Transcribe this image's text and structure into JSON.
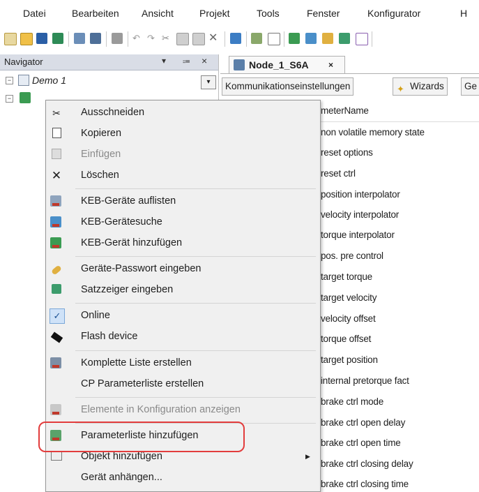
{
  "menubar": {
    "items": [
      "Datei",
      "Bearbeiten",
      "Ansicht",
      "Projekt",
      "Tools",
      "Fenster",
      "Konfigurator",
      "H"
    ]
  },
  "navigator": {
    "title": "Navigator",
    "pin": "▾",
    "dock": "⩴",
    "close": "×",
    "tree_root": "Demo 1"
  },
  "document": {
    "tab_label": "Node_1_S6A",
    "tab_close": "×",
    "subtabs": [
      "Kommunikationseinstellungen",
      "Wizards",
      "Ge"
    ],
    "column_header": "meterName",
    "rows": [
      "non volatile memory state",
      "reset options",
      "reset ctrl",
      "position interpolator",
      "velocity interpolator",
      "torque interpolator",
      "pos. pre control",
      "target torque",
      "target velocity",
      "velocity offset",
      "torque offset",
      "target position",
      "internal pretorque fact",
      "brake ctrl mode",
      "brake ctrl open delay",
      "brake ctrl open time",
      "brake ctrl closing delay",
      "brake ctrl closing time"
    ]
  },
  "context_menu": {
    "items": [
      {
        "label": "Ausschneiden",
        "icon": "scissors-icon",
        "enabled": true
      },
      {
        "label": "Kopieren",
        "icon": "copy-icon",
        "enabled": true
      },
      {
        "label": "Einfügen",
        "icon": "paste-icon",
        "enabled": false
      },
      {
        "label": "Löschen",
        "icon": "delete-icon",
        "enabled": true
      },
      {
        "label": "KEB-Geräte auflisten",
        "icon": "keb-list-icon",
        "enabled": true
      },
      {
        "label": "KEB-Gerätesuche",
        "icon": "keb-search-icon",
        "enabled": true
      },
      {
        "label": "KEB-Gerät hinzufügen",
        "icon": "keb-add-icon",
        "enabled": true
      },
      {
        "label": "Geräte-Passwort eingeben",
        "icon": "key-icon",
        "enabled": true
      },
      {
        "label": "Satzzeiger eingeben",
        "icon": "record-pointer-icon",
        "enabled": true
      },
      {
        "label": "Online",
        "icon": "check-icon",
        "enabled": true,
        "checked": true
      },
      {
        "label": "Flash device",
        "icon": "chip-icon",
        "enabled": true
      },
      {
        "label": "Komplette Liste erstellen",
        "icon": "keb-list-full-icon",
        "enabled": true
      },
      {
        "label": "CP Parameterliste erstellen",
        "icon": "",
        "enabled": true
      },
      {
        "label": "Elemente in Konfiguration anzeigen",
        "icon": "keb-config-icon",
        "enabled": false
      },
      {
        "label": "Parameterliste hinzufügen",
        "icon": "keb-paramlist-add-icon",
        "enabled": true,
        "highlighted": true
      },
      {
        "label": "Objekt hinzufügen",
        "icon": "object-add-icon",
        "enabled": true,
        "submenu": true
      },
      {
        "label": "Gerät anhängen...",
        "icon": "",
        "enabled": true
      }
    ]
  },
  "colors": {
    "highlight_border": "#e23c3c",
    "keb_red": "#c0392b",
    "menu_bg": "#f0f0f0"
  }
}
